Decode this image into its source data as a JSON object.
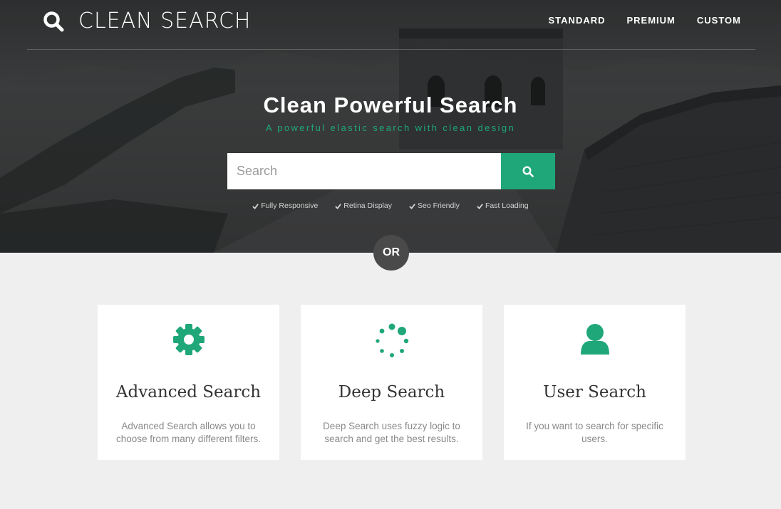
{
  "brand": {
    "name": "CLEAN SEARCH",
    "icon": "search-icon"
  },
  "nav": {
    "items": [
      "STANDARD",
      "PREMIUM",
      "CUSTOM"
    ]
  },
  "hero": {
    "title": "Clean Powerful Search",
    "subtitle": "A powerful elastic search with clean design",
    "search_placeholder": "Search",
    "search_value": "",
    "features": [
      "Fully Responsive",
      "Retina Display",
      "Seo Friendly",
      "Fast Loading"
    ]
  },
  "or_label": "OR",
  "cards": [
    {
      "icon": "gear-icon",
      "title": "Advanced Search",
      "description": "Advanced Search allows you to choose from many different filters."
    },
    {
      "icon": "spinner-icon",
      "title": "Deep Search",
      "description": "Deep Search uses fuzzy logic to search and get the best results."
    },
    {
      "icon": "user-icon",
      "title": "User Search",
      "description": "If you want to search for specific users."
    }
  ],
  "colors": {
    "accent": "#1fa77a",
    "hero_bg": "#434546",
    "page_bg": "#efefef",
    "or_badge": "#4a4a4a"
  }
}
